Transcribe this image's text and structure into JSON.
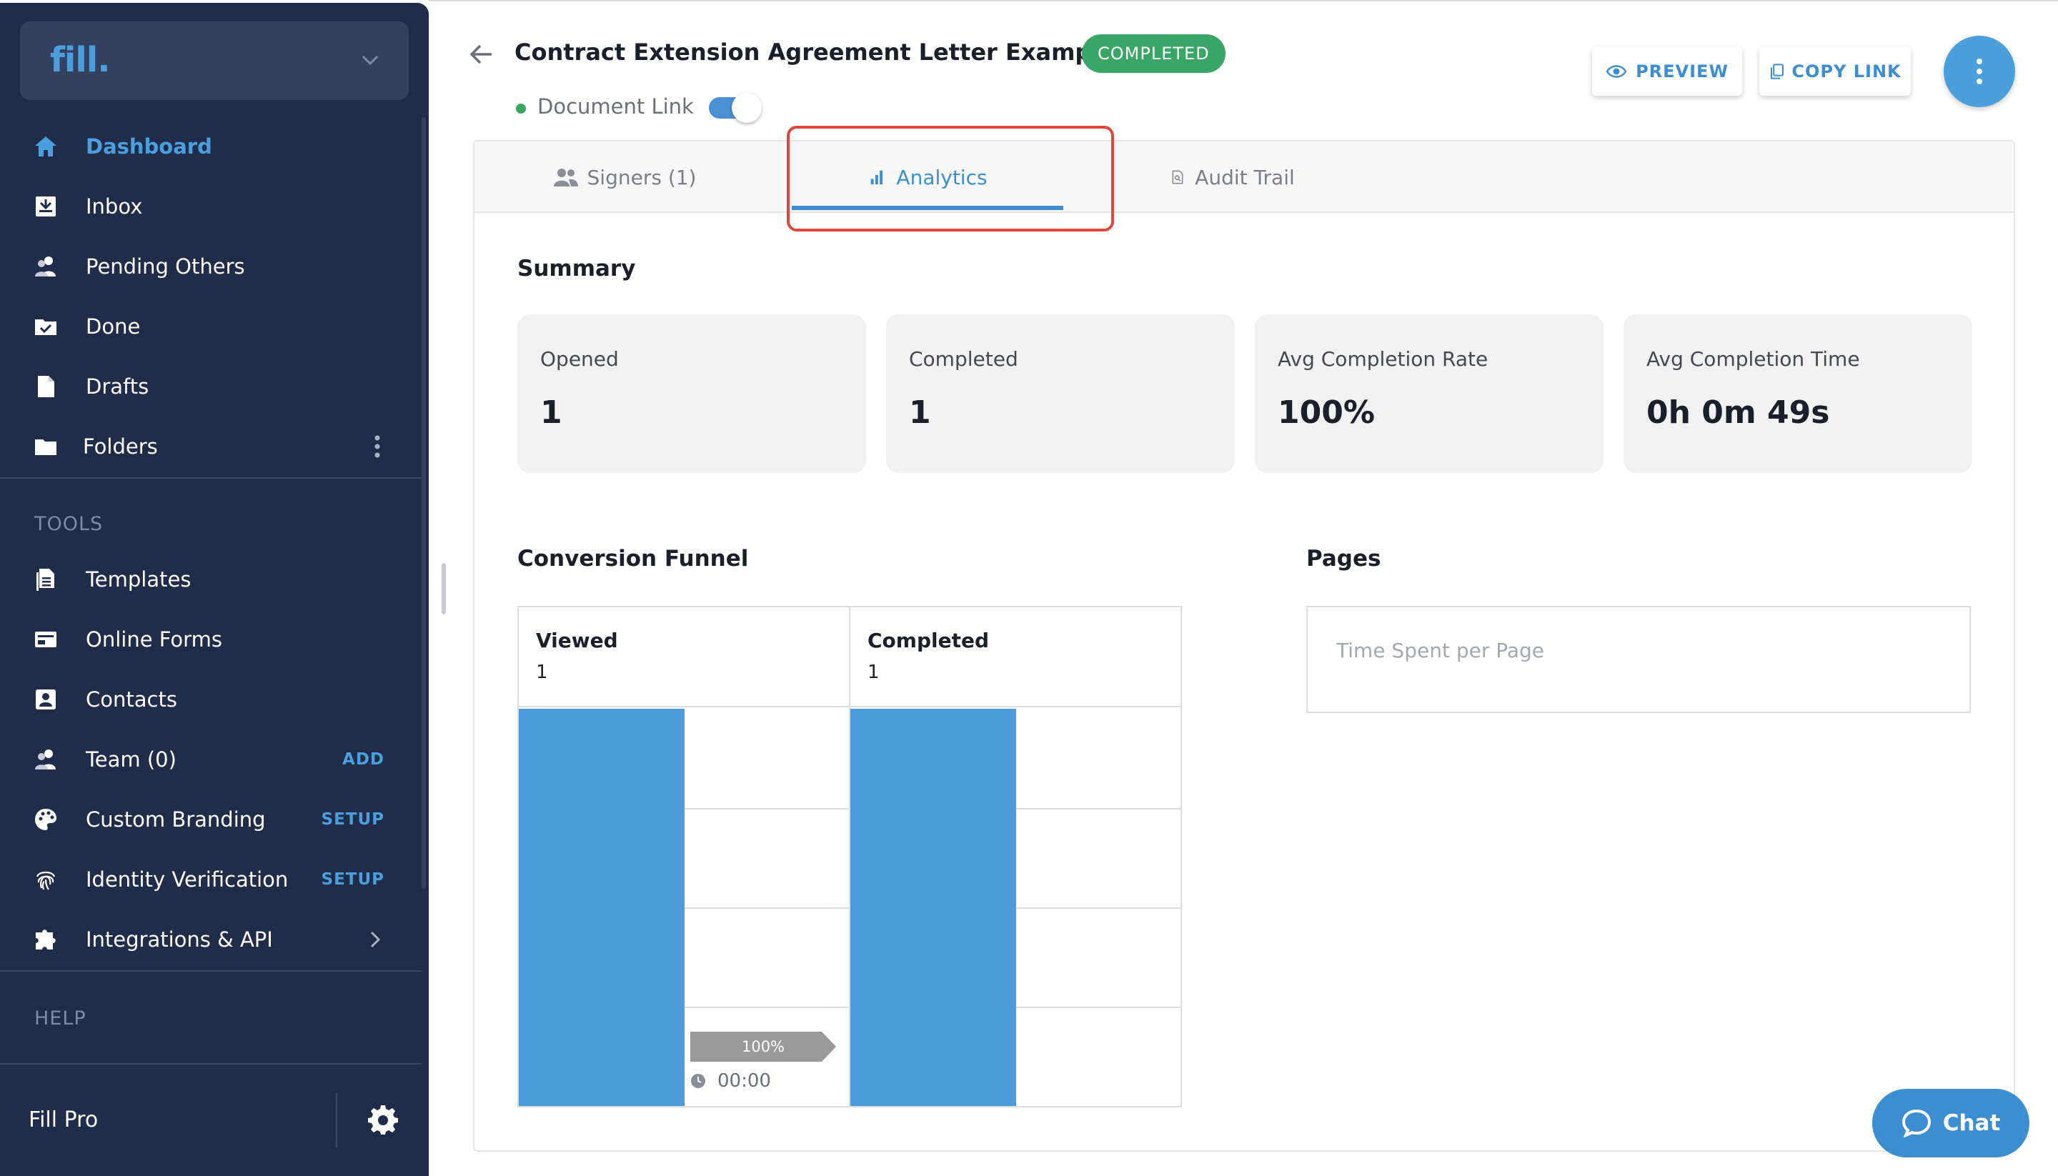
{
  "colors": {
    "sidebar_bg": "#1f2c4a",
    "accent": "#4a9fdc",
    "status_green": "#3aa665",
    "bar_blue": "#4a9dd8",
    "highlight_red": "#e0473a"
  },
  "sidebar": {
    "brand": "fill.",
    "nav": [
      {
        "label": "Dashboard",
        "icon": "home-icon"
      },
      {
        "label": "Inbox",
        "icon": "inbox-icon"
      },
      {
        "label": "Pending Others",
        "icon": "users-icon"
      },
      {
        "label": "Done",
        "icon": "folder-check-icon"
      },
      {
        "label": "Drafts",
        "icon": "file-icon"
      },
      {
        "label": "Folders",
        "icon": "folder-icon"
      }
    ],
    "tools_heading": "TOOLS",
    "tools": [
      {
        "label": "Templates",
        "icon": "templates-icon",
        "badge": ""
      },
      {
        "label": "Online Forms",
        "icon": "form-icon",
        "badge": ""
      },
      {
        "label": "Contacts",
        "icon": "contact-icon",
        "badge": ""
      },
      {
        "label": "Team (0)",
        "icon": "team-icon",
        "badge": "ADD"
      },
      {
        "label": "Custom Branding",
        "icon": "palette-icon",
        "badge": "SETUP"
      },
      {
        "label": "Identity Verification",
        "icon": "fingerprint-icon",
        "badge": "SETUP"
      },
      {
        "label": "Integrations & API",
        "icon": "puzzle-icon",
        "badge": ""
      }
    ],
    "help_heading": "HELP",
    "footer": {
      "plan": "Fill Pro"
    }
  },
  "header": {
    "title": "Contract Extension Agreement Letter Example",
    "status": "COMPLETED",
    "doc_link_label": "Document Link",
    "doc_link_enabled": true,
    "preview_label": "PREVIEW",
    "copy_link_label": "COPY LINK"
  },
  "tabs": [
    {
      "label": "Signers (1)",
      "icon": "people-icon"
    },
    {
      "label": "Analytics",
      "icon": "bar-chart-icon",
      "active": true
    },
    {
      "label": "Audit Trail",
      "icon": "audit-icon"
    }
  ],
  "summary": {
    "title": "Summary",
    "cards": [
      {
        "label": "Opened",
        "value": "1"
      },
      {
        "label": "Completed",
        "value": "1"
      },
      {
        "label": "Avg Completion Rate",
        "value": "100%"
      },
      {
        "label": "Avg Completion Time",
        "value": "0h 0m 49s"
      }
    ]
  },
  "funnel": {
    "title": "Conversion Funnel",
    "conversion_label": "100%",
    "time_label": "00:00"
  },
  "chart_data": {
    "type": "bar",
    "title": "Conversion Funnel",
    "categories": [
      "Viewed",
      "Completed"
    ],
    "values": [
      1,
      1
    ],
    "ylim": [
      0,
      1
    ]
  },
  "pages": {
    "title": "Pages",
    "placeholder": "Time Spent per Page"
  },
  "chat": {
    "label": "Chat"
  }
}
